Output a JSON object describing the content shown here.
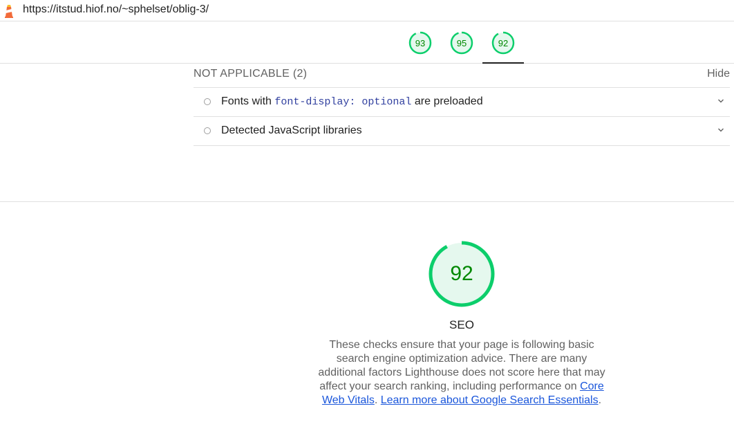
{
  "header": {
    "url": "https://itstud.hiof.no/~sphelset/oblig-3/",
    "logo_icon": "lighthouse-icon"
  },
  "scores": [
    {
      "value": "93"
    },
    {
      "value": "95"
    },
    {
      "value": "92",
      "active": true
    }
  ],
  "colors": {
    "pass": "#0cce6b",
    "pass_text": "#008800",
    "pass_fill": "#e5f8ee",
    "link": "#1a56db",
    "code": "#303f9f"
  },
  "not_applicable": {
    "title": "NOT APPLICABLE",
    "count": "(2)",
    "hide_label": "Hide",
    "audits": [
      {
        "title_before": "Fonts with ",
        "code": "font-display: optional",
        "title_after": " are preloaded",
        "icon": "chevron-down-icon"
      },
      {
        "title": "Detected JavaScript libraries",
        "icon": "chevron-down-icon"
      }
    ]
  },
  "seo": {
    "score": "92",
    "label": "SEO",
    "description": "These checks ensure that your page is following basic search engine optimization advice. There are many additional factors Lighthouse does not score here that may affect your search ranking, including performance on ",
    "link1": "Core Web Vitals",
    "sep": ". ",
    "link2": "Learn more about Google Search Essentials",
    "end": "."
  }
}
